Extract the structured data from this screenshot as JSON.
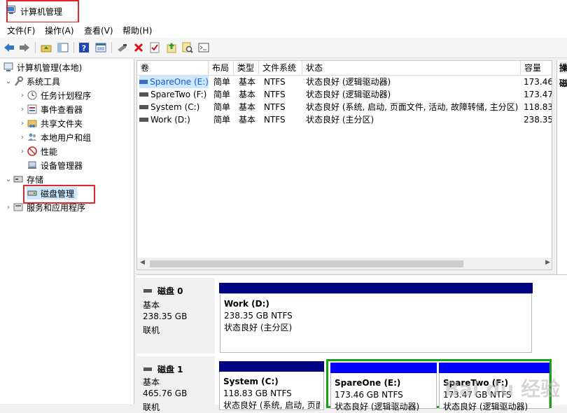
{
  "window": {
    "title": "计算机管理"
  },
  "menu": [
    "文件(F)",
    "操作(A)",
    "查看(V)",
    "帮助(H)"
  ],
  "toolbar": [
    "back-icon",
    "forward-icon",
    "up-folder-icon",
    "show-tree-icon",
    "help-icon",
    "properties-icon",
    "connect-icon",
    "delete-icon",
    "check-icon",
    "export-icon",
    "search-icon",
    "console-icon"
  ],
  "tree": {
    "root": "计算机管理(本地)",
    "system_tools": "系统工具",
    "task_scheduler": "任务计划程序",
    "event_viewer": "事件查看器",
    "shared_folders": "共享文件夹",
    "local_users": "本地用户和组",
    "performance": "性能",
    "device_manager": "设备管理器",
    "storage": "存储",
    "disk_management": "磁盘管理",
    "services_apps": "服务和应用程序"
  },
  "list": {
    "headers": [
      "卷",
      "布局",
      "类型",
      "文件系统",
      "状态",
      "容量"
    ],
    "rows": [
      [
        "SpareOne (E:)",
        "简单",
        "基本",
        "NTFS",
        "状态良好 (逻辑驱动器)",
        "173.46"
      ],
      [
        "SpareTwo (F:)",
        "简单",
        "基本",
        "NTFS",
        "状态良好 (逻辑驱动器)",
        "173.47"
      ],
      [
        "System (C:)",
        "简单",
        "基本",
        "NTFS",
        "状态良好 (系统, 启动, 页面文件, 活动, 故障转储, 主分区)",
        "118.83"
      ],
      [
        "Work (D:)",
        "简单",
        "基本",
        "NTFS",
        "状态良好 (主分区)",
        "238.35"
      ]
    ]
  },
  "action_pane": {
    "header": "操",
    "item": "磁"
  },
  "disks": {
    "disk0": {
      "name": "磁盘 0",
      "type": "基本",
      "size": "238.35 GB",
      "status": "联机",
      "vol": {
        "name": "Work  (D:)",
        "size": "238.35 GB NTFS",
        "status": "状态良好 (主分区)"
      }
    },
    "disk1": {
      "name": "磁盘 1",
      "type": "基本",
      "size": "465.76 GB",
      "status": "联机",
      "vols": [
        {
          "name": "System  (C:)",
          "size": "118.83 GB NTFS",
          "status": "状态良好 (系统, 启动, 页面"
        },
        {
          "name": "SpareOne  (E:)",
          "size": "173.46 GB NTFS",
          "status": "状态良好 (逻辑驱动器)"
        },
        {
          "name": "SpareTwo  (F:)",
          "size": "173.47 GB NTFS",
          "status": "状态良好 (逻辑驱动器)"
        }
      ]
    }
  },
  "watermark": "Bai du 经验",
  "colors": {
    "primary_bar": "#020381",
    "logical_bar": "#0000ff",
    "extended_border": "#1aa01a",
    "highlight": "#cce8ff",
    "red_box": "#e3262a"
  }
}
